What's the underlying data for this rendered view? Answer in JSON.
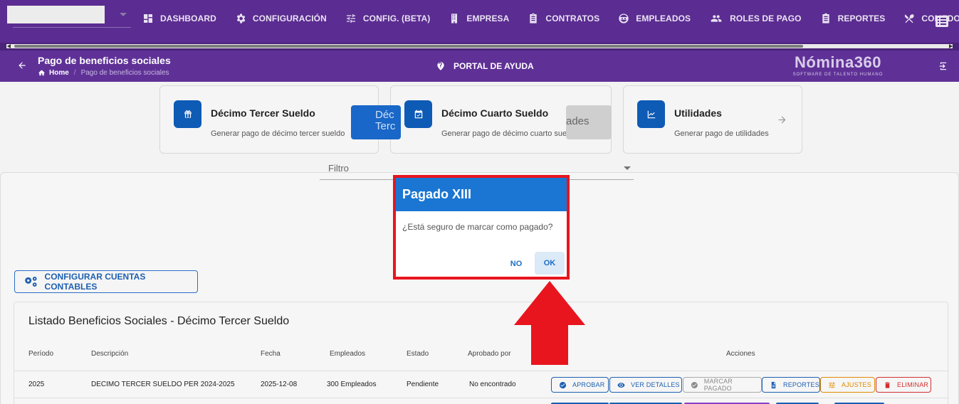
{
  "topnav": {
    "company_value": "",
    "items": [
      {
        "label": "DASHBOARD",
        "icon": "dashboard-icon"
      },
      {
        "label": "CONFIGURACIÓN",
        "icon": "gear-icon"
      },
      {
        "label": "CONFIG. (BETA)",
        "icon": "sliders-icon"
      },
      {
        "label": "EMPRESA",
        "icon": "building-icon"
      },
      {
        "label": "CONTRATOS",
        "icon": "clipboard-icon"
      },
      {
        "label": "EMPLEADOS",
        "icon": "face-icon"
      },
      {
        "label": "ROLES DE PAGO",
        "icon": "people-icon"
      },
      {
        "label": "REPORTES",
        "icon": "report-icon"
      },
      {
        "label": "COMEDOR",
        "icon": "utensils-icon"
      }
    ]
  },
  "subheader": {
    "title": "Pago de beneficios sociales",
    "breadcrumb_home": "Home",
    "breadcrumb_sep": "/",
    "breadcrumb_current": "Pago de beneficios sociales",
    "help_label": "PORTAL DE AYUDA",
    "brand_name": "Nómina360",
    "brand_tagline": "SOFTWARE DE TALENTO HUMANO"
  },
  "cards": [
    {
      "title": "Décimo Tercer Sueldo",
      "subtitle": "Generar pago de décimo tercer sueldo",
      "icon": "gift-icon"
    },
    {
      "title": "Décimo Cuarto Sueldo",
      "subtitle": "Generar pago de décimo cuarto sueldo",
      "icon": "calendar-check-icon"
    },
    {
      "title": "Utilidades",
      "subtitle": "Generar pago de utilidades",
      "icon": "trending-icon"
    }
  ],
  "tabs": {
    "left_label": "Déc\nTerc",
    "right_label": "ades"
  },
  "filter": {
    "label": "Filtro"
  },
  "config_button": "CONFIGURAR CUENTAS CONTABLES",
  "list": {
    "title": "Listado Beneficios Sociales - Décimo Tercer Sueldo",
    "headers": [
      "Período",
      "Descripción",
      "Fecha",
      "Empleados",
      "Estado",
      "Aprobado por",
      "Acciones"
    ],
    "row": {
      "periodo": "2025",
      "descripcion": "DECIMO TERCER SUELDO PER 2024-2025",
      "fecha": "2025-12-08",
      "empleados": "300 Empleados",
      "estado": "Pendiente",
      "aprobado_por": "No encontrado"
    },
    "actions": [
      {
        "label": "APROBAR",
        "color": "#1d5fb0"
      },
      {
        "label": "VER DETALLES",
        "color": "#1d5fb0"
      },
      {
        "label": "MARCAR PAGADO",
        "color": "#8a8a8a"
      },
      {
        "label": "REPORTES",
        "color": "#1d5fb0"
      },
      {
        "label": "AJUSTES",
        "color": "#e08a00"
      },
      {
        "label": "ELIMINAR",
        "color": "#d32f2f"
      }
    ]
  },
  "dialog": {
    "title": "Pagado XIII",
    "message": "¿Está seguro de marcar como pagado?",
    "no_label": "NO",
    "ok_label": "OK"
  },
  "colors": {
    "nav_bg": "#5b2c91",
    "dialog_header": "#1a76d2",
    "highlight_red": "#e8151e",
    "primary_blue": "#0d5bb5"
  }
}
